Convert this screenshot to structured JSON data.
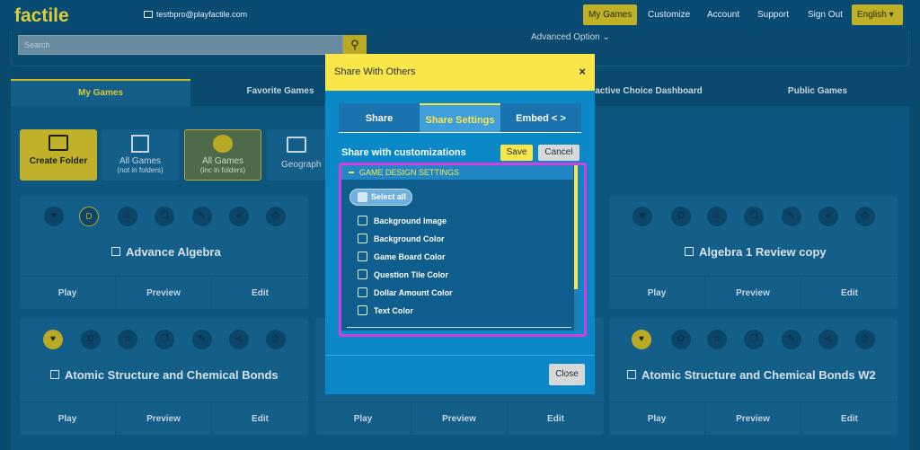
{
  "app": {
    "logo": "factile"
  },
  "nav": {
    "email": "testbpro@playfactile.com",
    "my_games": "My Games",
    "customize": "Customize",
    "account": "Account",
    "support": "Support",
    "sign_out": "Sign Out",
    "language": "English ▾"
  },
  "search": {
    "placeholder": "Search",
    "advanced": "Advanced Option"
  },
  "tabs": [
    "My Games",
    "Favorite Games",
    "active Choice Dashboard",
    "Public Games"
  ],
  "tiles": {
    "create": "Create Folder",
    "all_games_nf": "All Games",
    "all_games_nf_sub": "(not in folders)",
    "all_games_if": "All Games",
    "all_games_if_sub": "(inc in folders)",
    "geography": "Geograph"
  },
  "cards": [
    {
      "title": "Advance Algebra",
      "play": "Play",
      "preview": "Preview",
      "edit": "Edit"
    },
    {
      "title": "Algebra 1 Review copy",
      "play": "Play",
      "preview": "Preview",
      "edit": "Edit"
    },
    {
      "title": "Atomic Structure and Chemical Bonds",
      "play": "Play",
      "preview": "Preview",
      "edit": "Edit"
    },
    {
      "title": "Atomic Structure and Chemical Bonds W2",
      "play": "Play",
      "preview": "Preview",
      "edit": "Edit"
    },
    {
      "play": "Play",
      "preview": "Preview",
      "edit": "Edit"
    }
  ],
  "card_icon_letter": "D",
  "modal": {
    "title": "Share With Others",
    "close_x": "×",
    "tabs": [
      "Share",
      "Share Settings",
      "Embed < >"
    ],
    "subtitle": "Share with customizations",
    "save": "Save",
    "cancel": "Cancel",
    "section": "GAME DESIGN SETTINGS",
    "select_all": "Select all",
    "options": [
      "Background Image",
      "Background Color",
      "Game Board Color",
      "Question Tile Color",
      "Dollar Amount Color",
      "Text Color"
    ],
    "close": "Close"
  },
  "colors": {
    "accent": "#fbe64a",
    "highlight": "#d63ee2",
    "modal_bg": "#0a88c7",
    "page_bg": "#0a4a6f"
  }
}
